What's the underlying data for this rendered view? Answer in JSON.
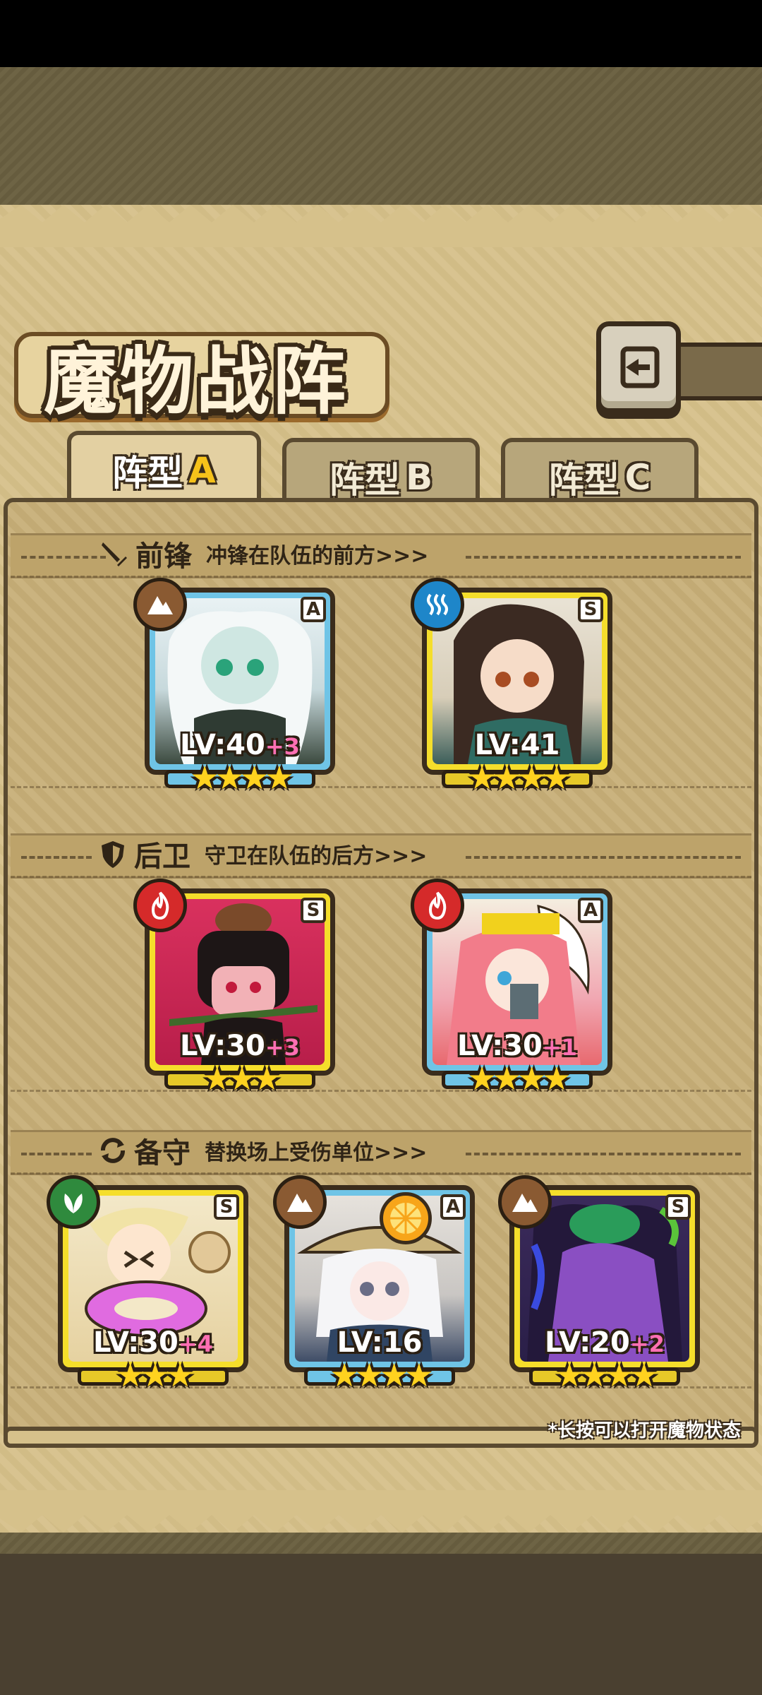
{
  "title": "魔物战阵",
  "back_button": {
    "icon": "back-arrow-icon"
  },
  "tabs": [
    {
      "label": "阵型",
      "letter": "A",
      "active": true
    },
    {
      "label": "阵型",
      "letter": "B",
      "active": false
    },
    {
      "label": "阵型",
      "letter": "C",
      "active": false
    }
  ],
  "sections": {
    "front": {
      "icon": "sword-icon",
      "name": "前锋",
      "desc": "冲锋在队伍的前方>>>"
    },
    "back": {
      "icon": "shield-icon",
      "name": "后卫",
      "desc": "守卫在队伍的后方>>>"
    },
    "reserve": {
      "icon": "swap-icon",
      "name": "备守",
      "desc": "替换场上受伤单位>>>"
    }
  },
  "cards": {
    "front1": {
      "rank": "A",
      "element": "earth-element-icon",
      "level": "LV:40",
      "bonus": "+3",
      "stars": "★★★★",
      "star_count": 4
    },
    "front2": {
      "rank": "S",
      "element": "water-element-icon",
      "level": "LV:41",
      "bonus": "",
      "stars": "★★★★",
      "star_count": 4
    },
    "back1": {
      "rank": "S",
      "element": "fire-element-icon",
      "level": "LV:30",
      "bonus": "+3",
      "stars": "★★★",
      "star_count": 3
    },
    "back2": {
      "rank": "A",
      "element": "fire-element-icon",
      "level": "LV:30",
      "bonus": "+1",
      "stars": "★★★★",
      "star_count": 4
    },
    "res1": {
      "rank": "S",
      "element": "wood-element-icon",
      "level": "LV:30",
      "bonus": "+4",
      "stars": "★★★",
      "star_count": 3
    },
    "res2": {
      "rank": "A",
      "element": "earth-element-icon",
      "level": "LV:16",
      "bonus": "",
      "stars": "★★★★",
      "star_count": 4
    },
    "res3": {
      "rank": "S",
      "element": "earth-element-icon",
      "level": "LV:20",
      "bonus": "+2",
      "stars": "★★★★",
      "star_count": 4
    }
  },
  "footnote": "*长按可以打开魔物状态",
  "colors": {
    "rank_S": "#f5de2b",
    "rank_A": "#6fc4e6",
    "bonus": "#ff6fb3",
    "star": "#ffd21f"
  }
}
